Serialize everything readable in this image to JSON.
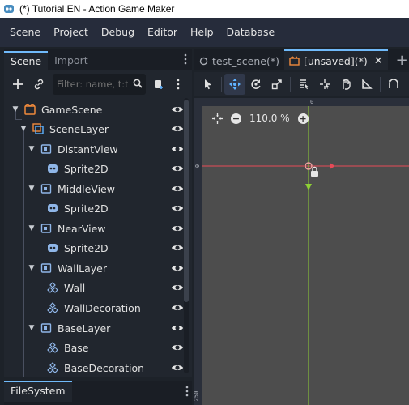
{
  "window": {
    "title": "(*) Tutorial EN - Action Game Maker"
  },
  "menu": [
    "Scene",
    "Project",
    "Debug",
    "Editor",
    "Help",
    "Database"
  ],
  "left_panel": {
    "tabs": [
      {
        "label": "Scene",
        "active": true
      },
      {
        "label": "Import",
        "active": false
      }
    ],
    "filter_placeholder": "Filter: name, t:t",
    "tree": [
      {
        "label": "GameScene",
        "icon": "scene-icon",
        "depth": 0,
        "expanded": true
      },
      {
        "label": "SceneLayer",
        "icon": "layer-icon",
        "depth": 1,
        "expanded": true
      },
      {
        "label": "DistantView",
        "icon": "view-icon",
        "depth": 2,
        "expanded": true
      },
      {
        "label": "Sprite2D",
        "icon": "sprite-icon",
        "depth": 3
      },
      {
        "label": "MiddleView",
        "icon": "view-icon",
        "depth": 2,
        "expanded": true
      },
      {
        "label": "Sprite2D",
        "icon": "sprite-icon",
        "depth": 3
      },
      {
        "label": "NearView",
        "icon": "view-icon",
        "depth": 2,
        "expanded": true
      },
      {
        "label": "Sprite2D",
        "icon": "sprite-icon",
        "depth": 3
      },
      {
        "label": "WallLayer",
        "icon": "view-icon",
        "depth": 2,
        "expanded": true
      },
      {
        "label": "Wall",
        "icon": "tilemap-icon",
        "depth": 3
      },
      {
        "label": "WallDecoration",
        "icon": "tilemap-icon",
        "depth": 3
      },
      {
        "label": "BaseLayer",
        "icon": "view-icon",
        "depth": 2,
        "expanded": true
      },
      {
        "label": "Base",
        "icon": "tilemap-icon",
        "depth": 3
      },
      {
        "label": "BaseDecoration",
        "icon": "tilemap-icon",
        "depth": 3
      }
    ]
  },
  "filesystem_tab": "FileSystem",
  "doc_tabs": [
    {
      "label": "test_scene(*)",
      "active": false
    },
    {
      "label": "[unsaved](*)",
      "active": true
    }
  ],
  "viewport": {
    "zoom": "110.0 %",
    "ruler_top": [
      "0"
    ],
    "ruler_left": [
      "0",
      "250"
    ]
  },
  "colors": {
    "accent": "#70bafa",
    "axis_x": "#e64a57",
    "axis_y": "#8ed135",
    "viewport_bg": "#4d4d4d"
  }
}
